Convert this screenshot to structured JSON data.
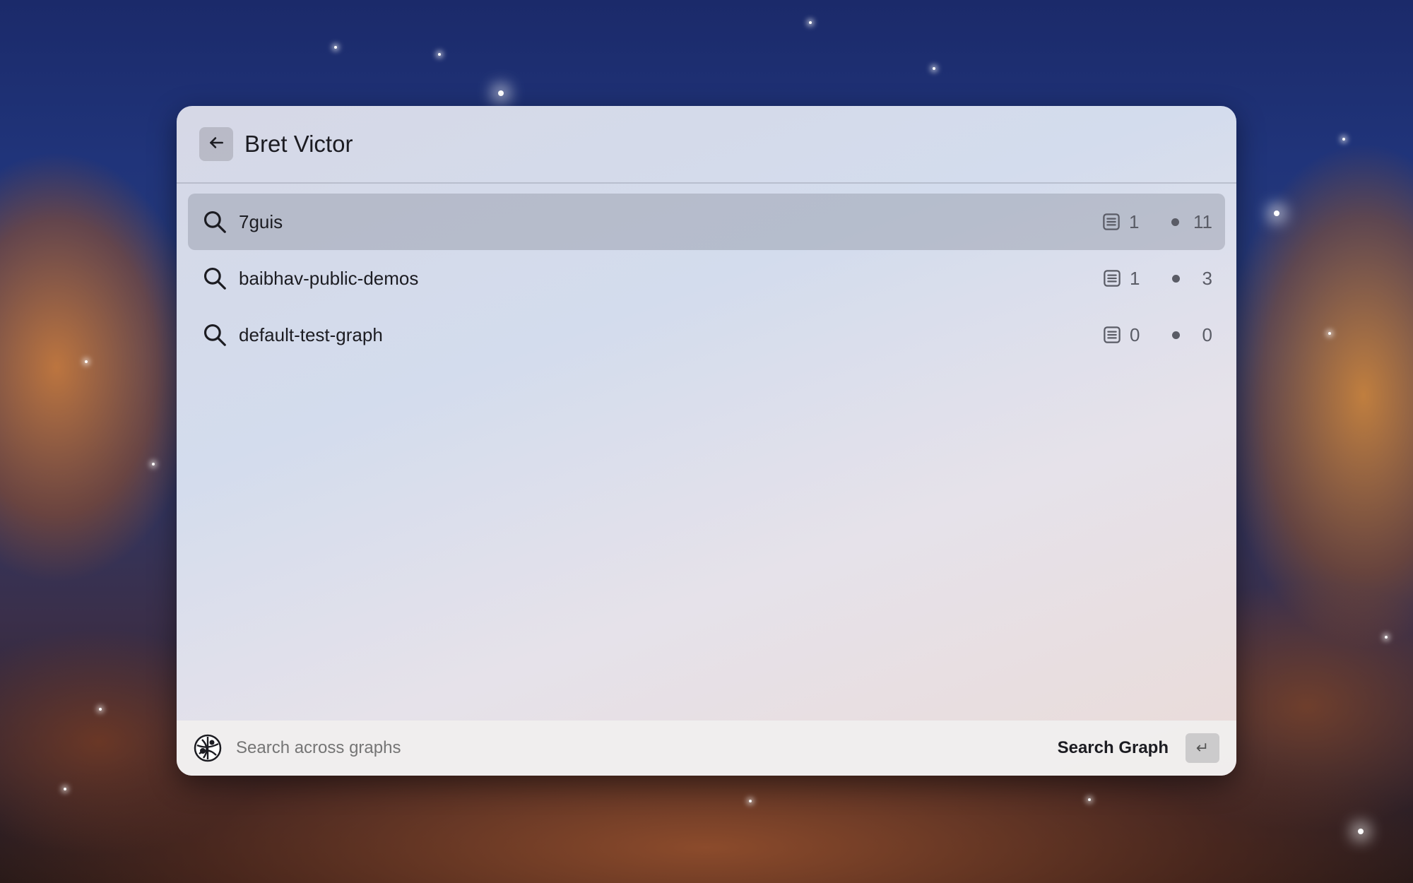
{
  "header": {
    "title": "Bret Victor",
    "back_icon": "arrow-left-icon"
  },
  "graphs": [
    {
      "name": "7guis",
      "docs": "1",
      "nodes": "11",
      "selected": true
    },
    {
      "name": "baibhav-public-demos",
      "docs": "1",
      "nodes": "3",
      "selected": false
    },
    {
      "name": "default-test-graph",
      "docs": "0",
      "nodes": "0",
      "selected": false
    }
  ],
  "footer": {
    "search_placeholder": "Search across graphs",
    "action_label": "Search Graph",
    "enter_key": "↵"
  },
  "colors": {
    "selected_row": "#a9adbb",
    "text": "#1c1c22",
    "muted": "#5a5c66"
  }
}
